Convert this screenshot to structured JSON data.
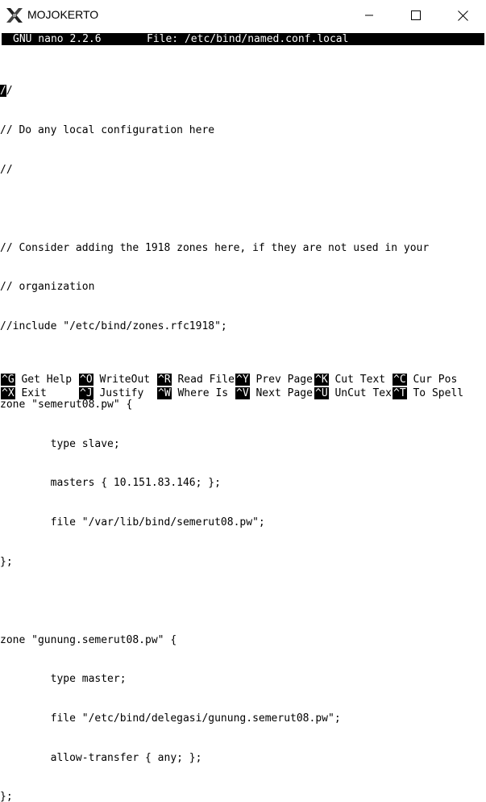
{
  "window": {
    "title": "MOJOKERTO",
    "minimize_label": "",
    "maximize_label": "",
    "close_label": ""
  },
  "nano": {
    "version": "GNU nano 2.2.6",
    "file_label": "File: /etc/bind/named.conf.local"
  },
  "editor": {
    "cursor_char": "/",
    "first_line_rest": "/",
    "lines": [
      "// Do any local configuration here",
      "//",
      "",
      "// Consider adding the 1918 zones here, if they are not used in your",
      "// organization",
      "//include \"/etc/bind/zones.rfc1918\";",
      "",
      "zone \"semerut08.pw\" {",
      "        type slave;",
      "        masters { 10.151.83.146; };",
      "        file \"/var/lib/bind/semerut08.pw\";",
      "};",
      "",
      "zone \"gunung.semerut08.pw\" {",
      "        type master;",
      "        file \"/etc/bind/delegasi/gunung.semerut08.pw\";",
      "        allow-transfer { any; };",
      "};"
    ]
  },
  "shortcuts": {
    "row1": [
      {
        "key": "^G",
        "label": "Get Help"
      },
      {
        "key": "^O",
        "label": "WriteOut"
      },
      {
        "key": "^R",
        "label": "Read File"
      },
      {
        "key": "^Y",
        "label": "Prev Page"
      },
      {
        "key": "^K",
        "label": "Cut Text"
      },
      {
        "key": "^C",
        "label": "Cur Pos"
      }
    ],
    "row2": [
      {
        "key": "^X",
        "label": "Exit"
      },
      {
        "key": "^J",
        "label": "Justify"
      },
      {
        "key": "^W",
        "label": "Where Is"
      },
      {
        "key": "^V",
        "label": "Next Page"
      },
      {
        "key": "^U",
        "label": "UnCut Text"
      },
      {
        "key": "^T",
        "label": "To Spell"
      }
    ]
  },
  "colors": {
    "terminal_bg": "#ffffff",
    "terminal_fg": "#000000",
    "inverse_bg": "#000000",
    "inverse_fg": "#ffffff"
  },
  "icons": {
    "app": "x-logo-icon",
    "minimize": "minimize-icon",
    "maximize": "maximize-icon",
    "close": "close-icon"
  }
}
